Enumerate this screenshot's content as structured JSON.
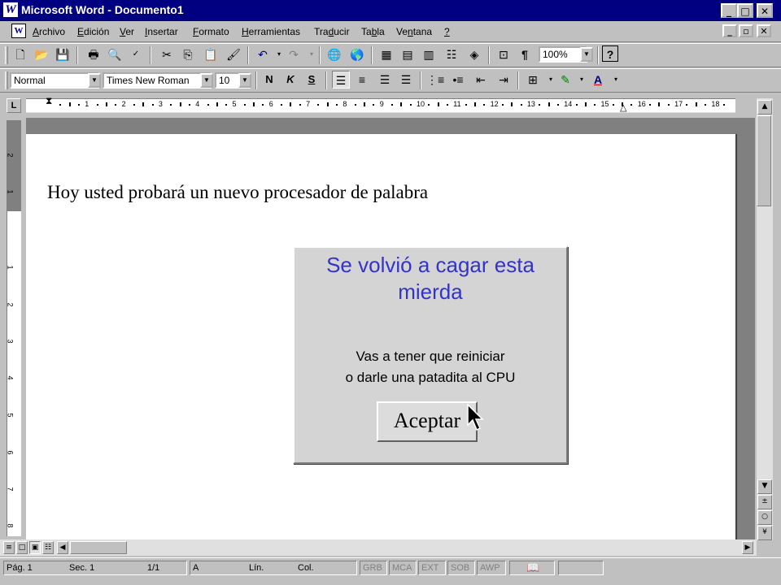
{
  "window": {
    "title": "Microsoft Word - Documento1",
    "app_icon": "W",
    "controls": [
      "_",
      "□",
      "✕"
    ]
  },
  "menubar": {
    "items": [
      {
        "label": "Archivo",
        "access_key": "A",
        "rest": "rchivo"
      },
      {
        "label": "Edición",
        "access_key": "E",
        "rest": "dición"
      },
      {
        "label": "Ver",
        "access_key": "V",
        "rest": "er"
      },
      {
        "label": "Insertar",
        "access_key": "I",
        "rest": "nsertar"
      },
      {
        "label": "Formato",
        "access_key": "F",
        "rest": "ormato"
      },
      {
        "label": "Herramientas",
        "access_key": "H",
        "rest": "erramientas"
      },
      {
        "label": "Traducir",
        "pre": "Tra",
        "access_key": "d",
        "rest": "ucir"
      },
      {
        "label": "Tabla",
        "pre": "Ta",
        "access_key": "b",
        "rest": "la"
      },
      {
        "label": "Ventana",
        "pre": "Ve",
        "access_key": "n",
        "rest": "tana"
      },
      {
        "label": "?",
        "access_key": "?",
        "rest": ""
      }
    ],
    "doc_controls": [
      "_",
      "▫",
      "✕"
    ]
  },
  "standard_toolbar": {
    "zoom": "100%"
  },
  "format_toolbar": {
    "style": "Normal",
    "font": "Times New Roman",
    "size": "10",
    "bold": "N",
    "italic": "K",
    "underline": "S",
    "font_color_letter": "A"
  },
  "ruler": {
    "numbers": [
      "1",
      "2",
      "3",
      "4",
      "5",
      "6",
      "7",
      "8",
      "9",
      "10",
      "11",
      "12",
      "13",
      "14",
      "15",
      "16",
      "17",
      "18"
    ]
  },
  "vertical_ruler": {
    "numbers": [
      "2",
      "1",
      "1",
      "2",
      "3",
      "4",
      "5",
      "6",
      "7",
      "8"
    ]
  },
  "document": {
    "text": "Hoy usted probará un nuevo procesador de palabra"
  },
  "dialog": {
    "title": "Se volvió a cagar esta mierda",
    "message_line1": "Vas a tener que reiniciar",
    "message_line2": "o darle una patadita al CPU",
    "button": "Aceptar"
  },
  "statusbar": {
    "page": "Pág. 1",
    "section": "Sec. 1",
    "pages": "1/1",
    "at": "A",
    "line": "Lín.",
    "col": "Col.",
    "grb": "GRB",
    "mca": "MCA",
    "ext": "EXT",
    "sob": "SOB",
    "awp": "AWP"
  }
}
